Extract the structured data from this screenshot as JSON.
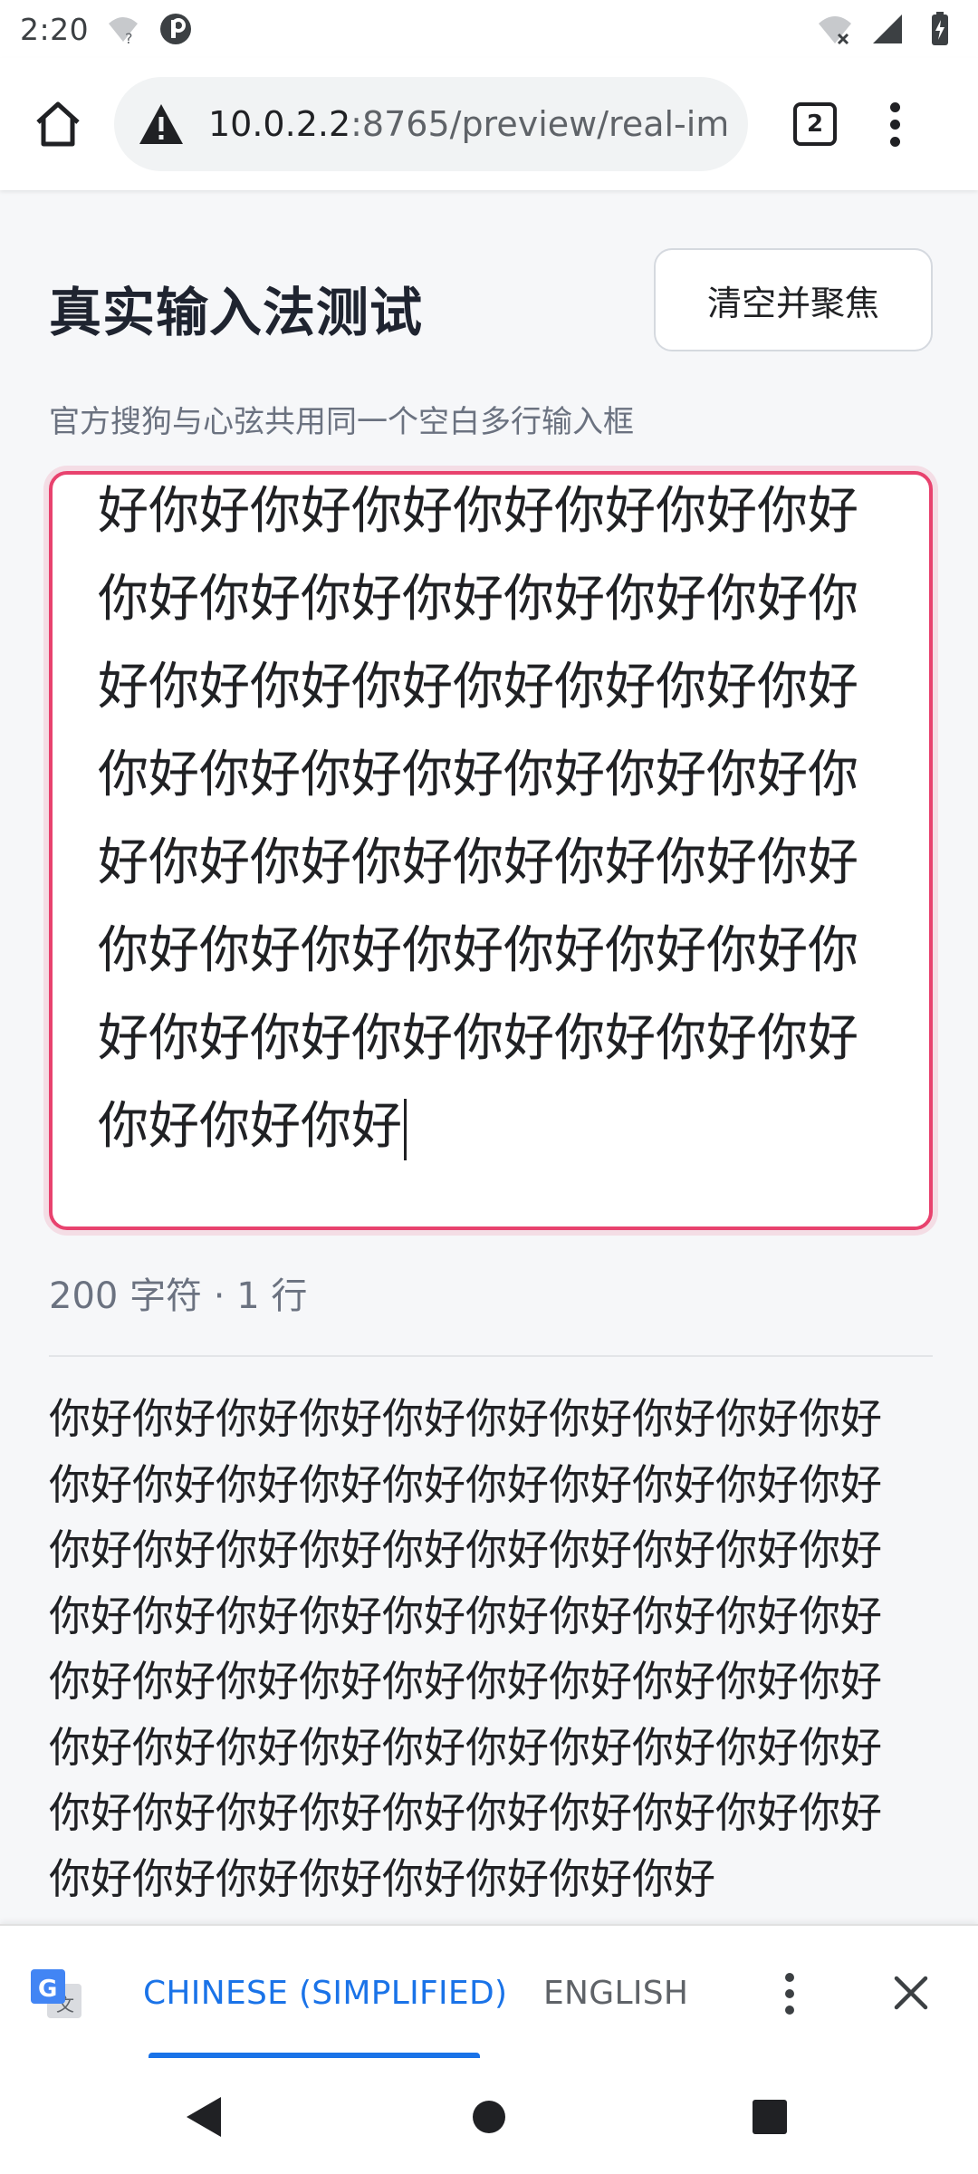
{
  "status_bar": {
    "time": "2:20",
    "icons": [
      "wifi-question-icon",
      "app-notification-icon",
      "wifi-off-icon",
      "signal-icon",
      "battery-icon"
    ]
  },
  "browser": {
    "url_host": "10.0.2.2",
    "url_rest": ":8765/preview/real-im",
    "tab_count": "2"
  },
  "page": {
    "title": "真实输入法测试",
    "clear_button_label": "清空并聚焦",
    "subtitle": "官方搜狗与心弦共用同一个空白多行输入框",
    "editor_text": "好你好你好你好你好你好你好你好你好你好你好你好你好你好你好你好你好你好你好你好你好你好你好你好你好你好你好你好你好你好你好你好你好你好你好你好你好你好你好你好你好你好你好你好你好你好你好你好你好你好你好你好你好你好你好你好",
    "counter": "200 字符 · 1 行",
    "preview_text": "你好你好你好你好你好你好你好你好你好你好你好你好你好你好你好你好你好你好你好你好你好你好你好你好你好你好你好你好你好你好你好你好你好你好你好你好你好你好你好你好你好你好你好你好你好你好你好你好你好你好你好你好你好你好你好你好你好你好你好你好你好你好你好你好你好你好你好你好你好你好你好你好你好你好你好你好你好你好"
  },
  "translate_bar": {
    "source_lang": "CHINESE (SIMPLIFIED)",
    "target_lang": "ENGLISH"
  },
  "colors": {
    "accent": "#1a73e8",
    "editor_border": "#e8426e",
    "page_background": "#f6f7f9"
  }
}
